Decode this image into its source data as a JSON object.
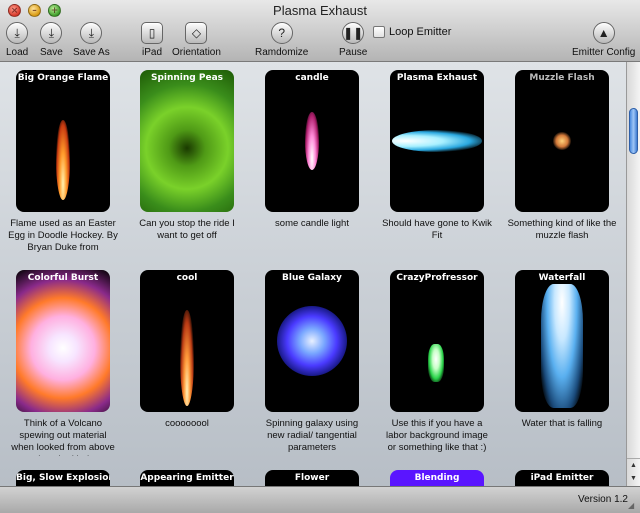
{
  "window": {
    "title": "Plasma Exhaust"
  },
  "toolbar": {
    "load": "Load",
    "save": "Save",
    "save_as": "Save As",
    "ipad": "iPad",
    "orientation": "Orientation",
    "randomize": "Ramdomize",
    "pause": "Pause",
    "loop_emitter": "Loop Emitter",
    "emitter_config": "Emitter Config"
  },
  "emitters": [
    {
      "name": "Big Orange Flame",
      "desc": "Flame used as an Easter Egg in Doodle Hockey.  By Bryan Duke from"
    },
    {
      "name": "Spinning Peas",
      "desc": "Can you stop the ride I want to get off"
    },
    {
      "name": "candle",
      "desc": "some candle light"
    },
    {
      "name": "Plasma Exhaust",
      "desc": "Should have gone to Kwik Fit"
    },
    {
      "name": "Muzzle Flash",
      "desc": "Something kind of like the muzzle flash"
    },
    {
      "name": "Colorful Burst",
      "desc": "Think of a Volcano spewing out material when looked from above (not the kind"
    },
    {
      "name": "cool",
      "desc": "coooooool"
    },
    {
      "name": "Blue Galaxy",
      "desc": "Spinning galaxy using new radial/ tangential parameters"
    },
    {
      "name": "CrazyProfressor",
      "desc": "Use this if you have a labor background image or something like that :)"
    },
    {
      "name": "Waterfall",
      "desc": "Water that is falling"
    },
    {
      "name": "Big, Slow Explosion"
    },
    {
      "name": "Appearing Emitter"
    },
    {
      "name": "Flower"
    },
    {
      "name": "Blending"
    },
    {
      "name": "iPad Emitter"
    }
  ],
  "status": {
    "version": "Version 1.2"
  },
  "colors": {
    "selected_card": "#5a15ff",
    "accent": "#4a8be0"
  }
}
